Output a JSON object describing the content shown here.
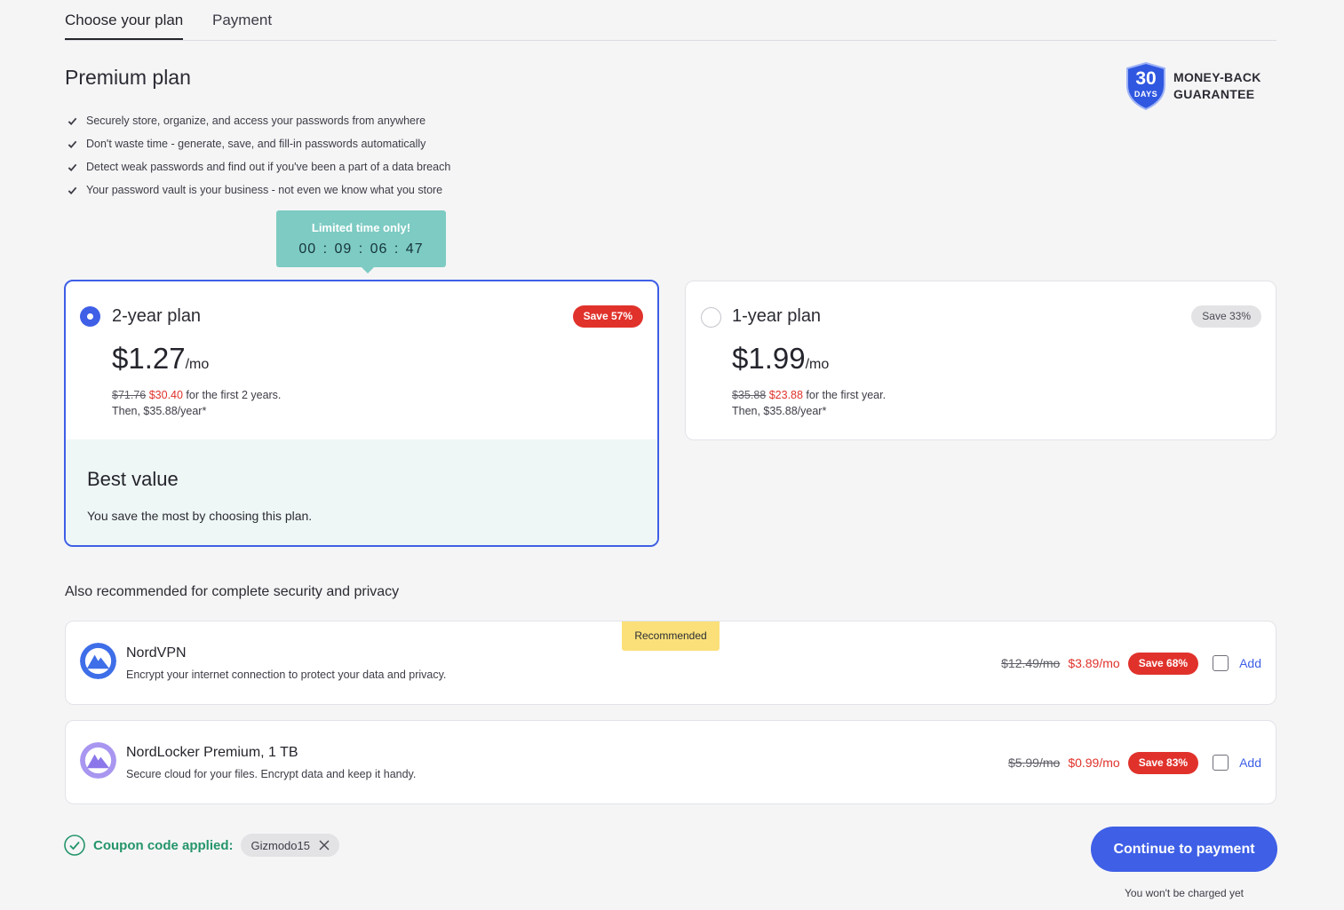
{
  "tabs": [
    "Choose your plan",
    "Payment"
  ],
  "title": "Premium plan",
  "features": [
    "Securely store, organize, and access your passwords from anywhere",
    "Don't waste time - generate, save, and fill-in passwords automatically",
    "Detect weak passwords and find out if you've been a part of a data breach",
    "Your password vault is your business - not even we know what you store"
  ],
  "guarantee": {
    "days_num": "30",
    "days_label": "DAYS",
    "line1": "MONEY-BACK",
    "line2": "GUARANTEE"
  },
  "timer": {
    "label": "Limited time only!",
    "time": "00 : 09 : 06 : 47"
  },
  "plans": [
    {
      "name": "2-year plan",
      "badge": "Save 57%",
      "price": "$1.27",
      "unit": "/mo",
      "old_total": "$71.76",
      "new_total": "$30.40",
      "period": " for the first 2 years.",
      "then": "Then, $35.88/year*",
      "selected": true,
      "best_title": "Best value",
      "best_desc": "You save the most by choosing this plan."
    },
    {
      "name": "1-year plan",
      "badge": "Save 33%",
      "price": "$1.99",
      "unit": "/mo",
      "old_total": "$35.88",
      "new_total": "$23.88",
      "period": " for the first year.",
      "then": "Then, $35.88/year*",
      "selected": false
    }
  ],
  "also_title": "Also recommended for complete security and privacy",
  "recommended_label": "Recommended",
  "addons": [
    {
      "name": "NordVPN",
      "desc": "Encrypt your internet connection to protect your data and privacy.",
      "old": "$12.49/mo",
      "new": "$3.89/mo",
      "badge": "Save 68%",
      "add": "Add"
    },
    {
      "name": "NordLocker Premium, 1 TB",
      "desc": "Secure cloud for your files. Encrypt data and keep it handy.",
      "old": "$5.99/mo",
      "new": "$0.99/mo",
      "badge": "Save 83%",
      "add": "Add"
    }
  ],
  "coupon": {
    "label": "Coupon code applied:",
    "code": "Gizmodo15"
  },
  "cta": "Continue to payment",
  "note": "You won't be charged yet",
  "colors": {
    "accent": "#3e5fe6",
    "sale": "#e0322b",
    "success": "#24956a",
    "timer": "#7dcbc3",
    "recommended": "#fbe07a"
  }
}
